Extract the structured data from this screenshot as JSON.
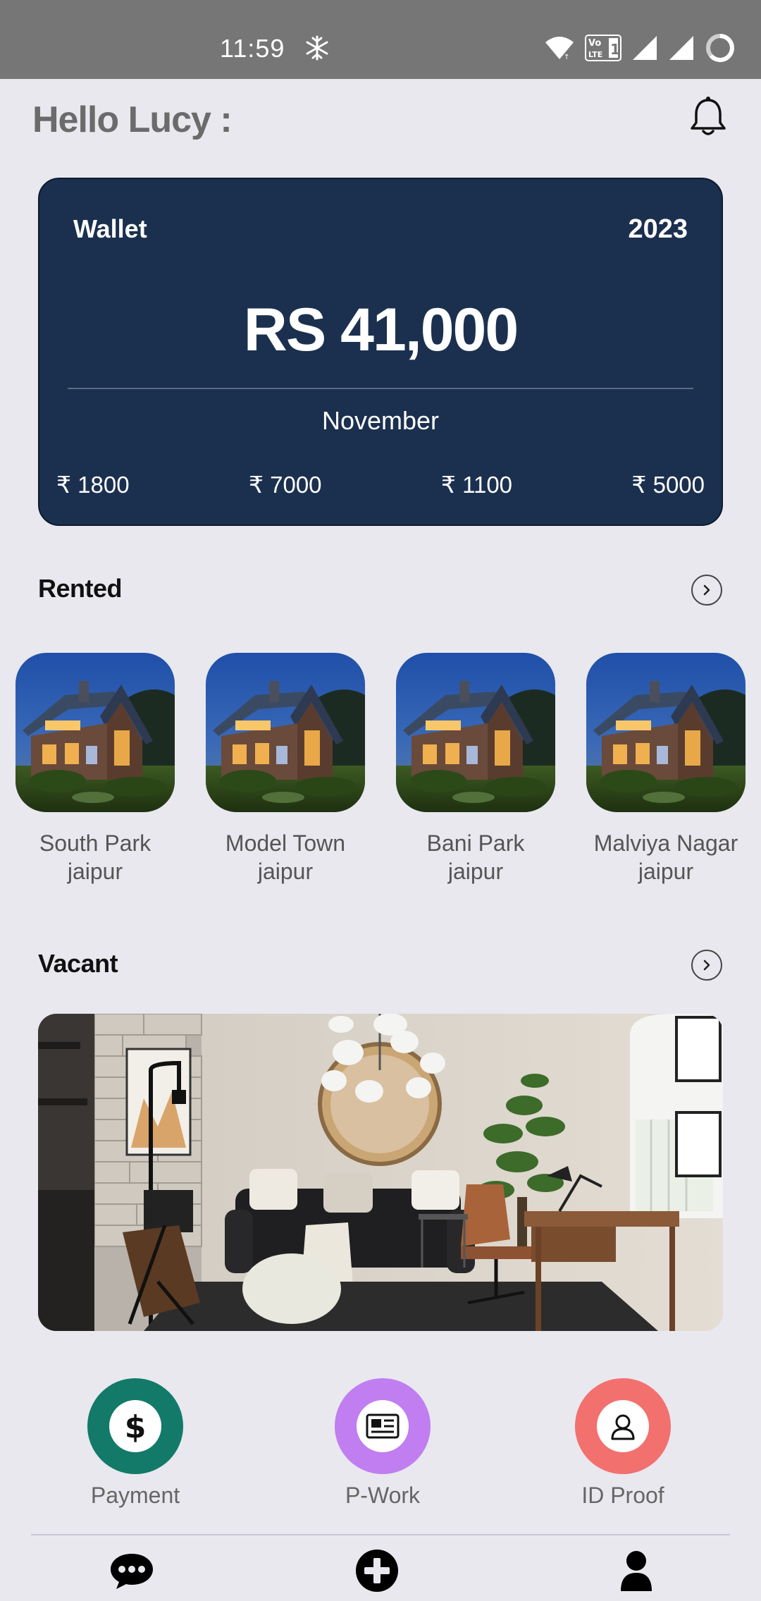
{
  "status_bar": {
    "time": "11:59",
    "icons": [
      "snowflake-icon",
      "wifi-icon",
      "volte-icon",
      "signal-icon",
      "signal-icon",
      "battery-icon"
    ]
  },
  "header": {
    "greeting": "Hello Lucy :",
    "notification_icon": "bell-icon"
  },
  "wallet": {
    "label": "Wallet",
    "year": "2023",
    "amount": "RS 41,000",
    "month": "November",
    "amounts": [
      "₹ 1800",
      "₹ 7000",
      "₹ 1100",
      "₹ 5000"
    ],
    "bg_color": "#1b304f"
  },
  "rented": {
    "title": "Rented",
    "items": [
      {
        "line1": "South Park",
        "line2": "jaipur"
      },
      {
        "line1": "Model Town",
        "line2": "jaipur"
      },
      {
        "line1": "Bani Park",
        "line2": "jaipur"
      },
      {
        "line1": "Malviya Nagar",
        "line2": "jaipur"
      }
    ]
  },
  "vacant": {
    "title": "Vacant"
  },
  "actions": [
    {
      "label": "Payment",
      "icon": "dollar-icon",
      "color": "#137a6a"
    },
    {
      "label": "P-Work",
      "icon": "newspaper-icon",
      "color": "#c07ef0"
    },
    {
      "label": "ID Proof",
      "icon": "user-icon",
      "color": "#f2706e"
    }
  ],
  "bottom_nav": [
    "chat-icon",
    "add-icon",
    "profile-icon"
  ]
}
